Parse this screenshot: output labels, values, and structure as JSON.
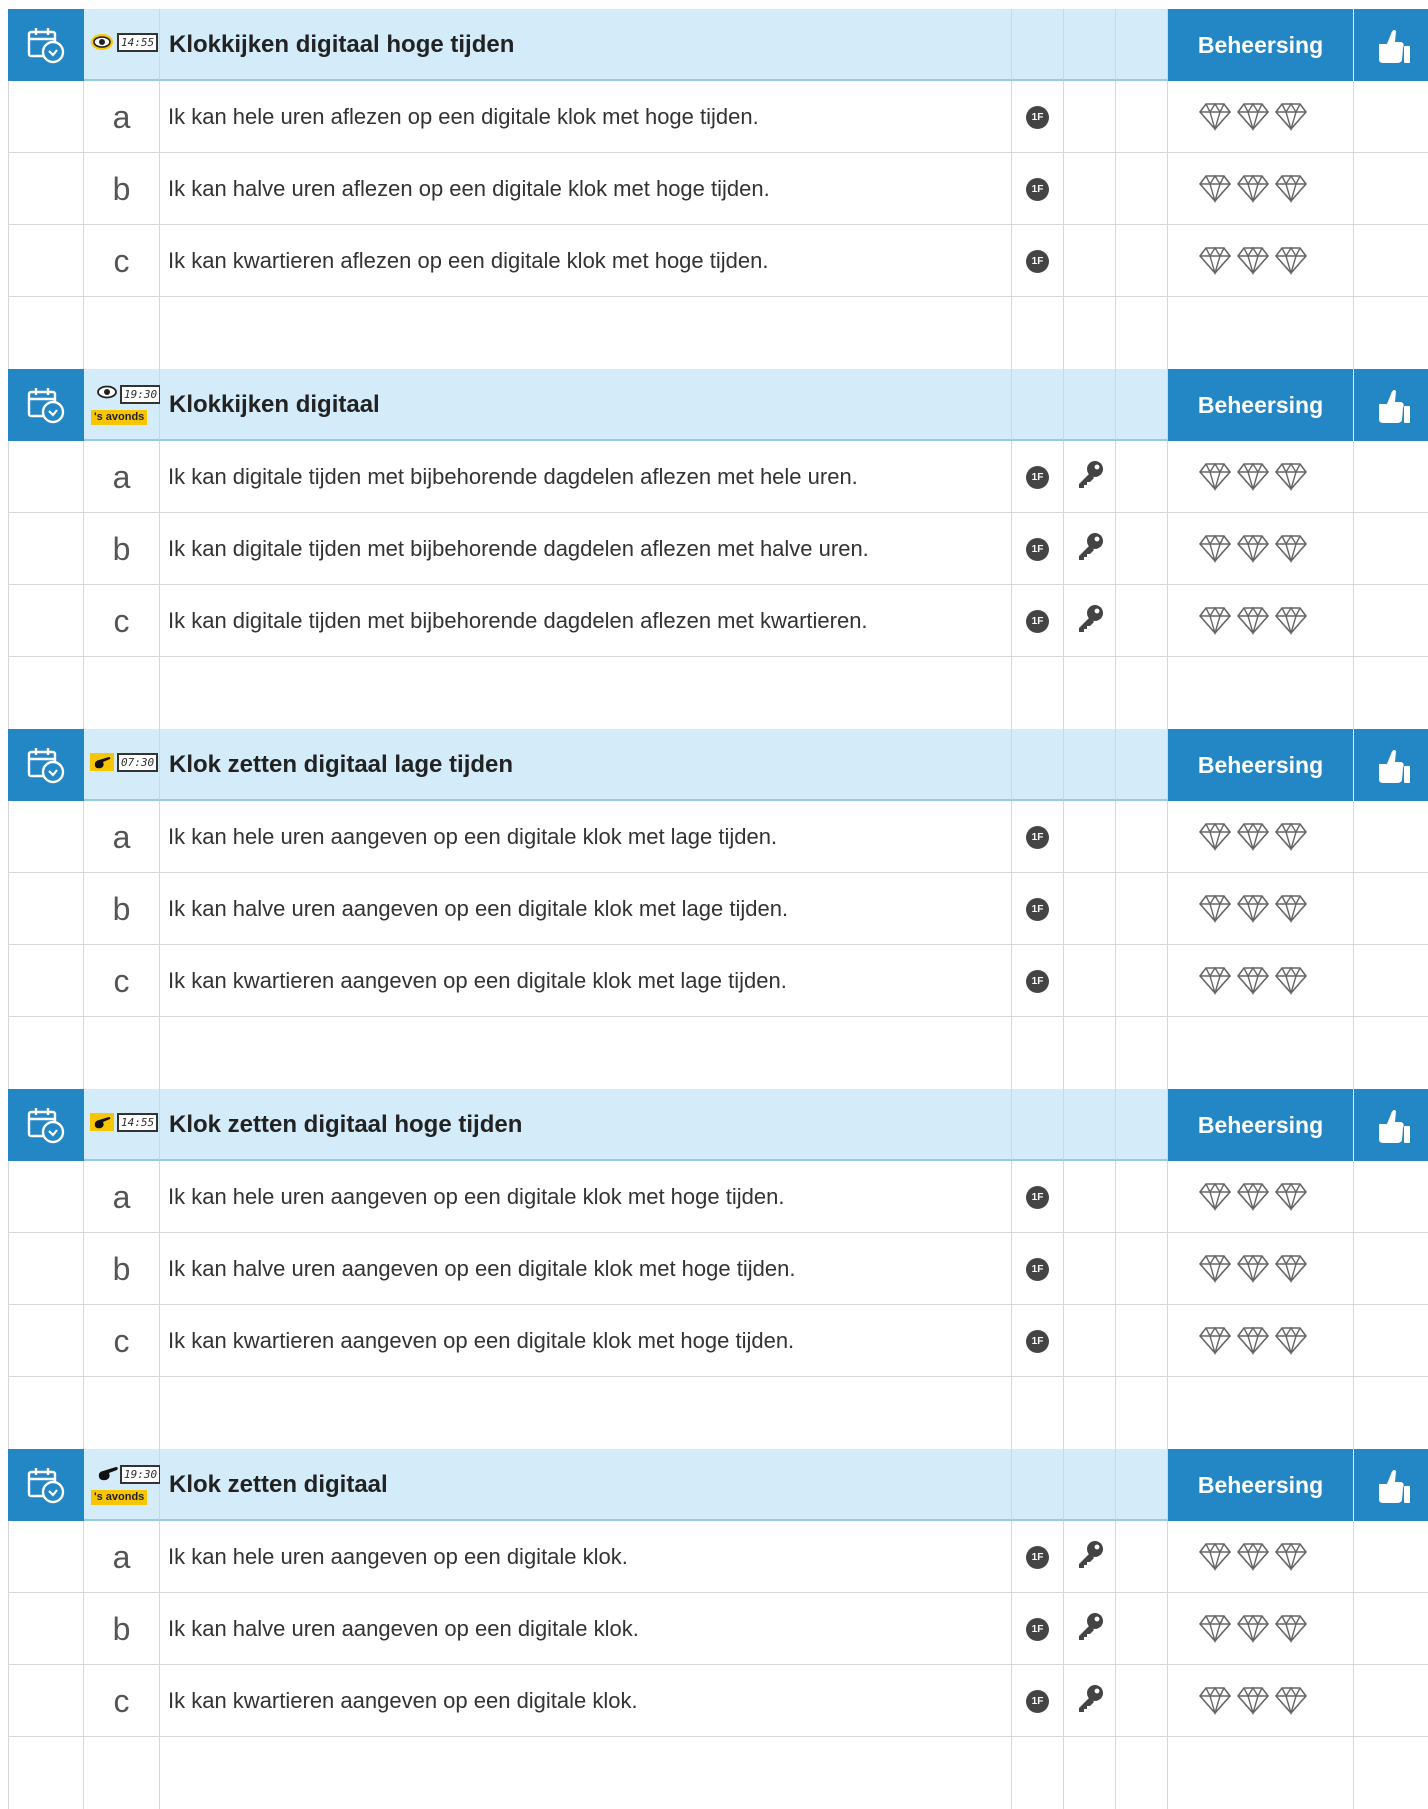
{
  "mastery_label": "Beheersing",
  "level_badge": "1F",
  "icon_names": {
    "calendar": "calendar-clock-icon",
    "thumb": "thumbs-up-icon",
    "key": "key-icon",
    "gem": "diamond-icon",
    "eye": "eye-icon",
    "hand": "pointing-hand-icon"
  },
  "colors": {
    "header_dark": "#2387c6",
    "header_light": "#d4ebf9",
    "tag_yellow": "#f7c600"
  },
  "sections": [
    {
      "title": "Klokkijken digitaal hoge tijden",
      "mode": "eye",
      "clock": "14:55",
      "tag": "",
      "items": [
        {
          "letter": "a",
          "text": "Ik kan hele uren aflezen op een digitale klok met hoge tijden.",
          "key": false
        },
        {
          "letter": "b",
          "text": "Ik kan halve uren aflezen op een digitale klok met hoge tijden.",
          "key": false
        },
        {
          "letter": "c",
          "text": "Ik kan kwartieren aflezen op een digitale klok met hoge tijden.",
          "key": false
        }
      ]
    },
    {
      "title": "Klokkijken digitaal",
      "mode": "eye",
      "clock": "19:30",
      "tag": "'s avonds",
      "items": [
        {
          "letter": "a",
          "text": "Ik kan digitale tijden met bijbehorende dagdelen aflezen met hele uren.",
          "key": true
        },
        {
          "letter": "b",
          "text": "Ik kan digitale tijden met bijbehorende dagdelen aflezen met halve uren.",
          "key": true
        },
        {
          "letter": "c",
          "text": "Ik kan digitale tijden met bijbehorende dagdelen aflezen met kwartieren.",
          "key": true
        }
      ]
    },
    {
      "title": "Klok zetten digitaal lage tijden",
      "mode": "hand",
      "clock": "07:30",
      "tag": "",
      "items": [
        {
          "letter": "a",
          "text": "Ik kan hele uren aangeven op een digitale klok met lage tijden.",
          "key": false
        },
        {
          "letter": "b",
          "text": "Ik kan halve uren aangeven op een digitale klok met lage tijden.",
          "key": false
        },
        {
          "letter": "c",
          "text": "Ik kan kwartieren aangeven op een digitale klok met lage tijden.",
          "key": false
        }
      ]
    },
    {
      "title": "Klok zetten digitaal hoge tijden",
      "mode": "hand",
      "clock": "14:55",
      "tag": "",
      "items": [
        {
          "letter": "a",
          "text": "Ik kan hele uren aangeven op een digitale klok met hoge tijden.",
          "key": false
        },
        {
          "letter": "b",
          "text": "Ik kan halve uren aangeven op een digitale klok met hoge tijden.",
          "key": false
        },
        {
          "letter": "c",
          "text": "Ik kan kwartieren aangeven op een digitale klok met hoge tijden.",
          "key": false
        }
      ]
    },
    {
      "title": "Klok zetten digitaal",
      "mode": "hand",
      "clock": "19:30",
      "tag": "'s avonds",
      "items": [
        {
          "letter": "a",
          "text": "Ik kan hele uren aangeven op een digitale klok.",
          "key": true
        },
        {
          "letter": "b",
          "text": "Ik kan halve uren aangeven op een digitale klok.",
          "key": true
        },
        {
          "letter": "c",
          "text": "Ik kan kwartieren aangeven op een digitale klok.",
          "key": true
        }
      ]
    }
  ]
}
